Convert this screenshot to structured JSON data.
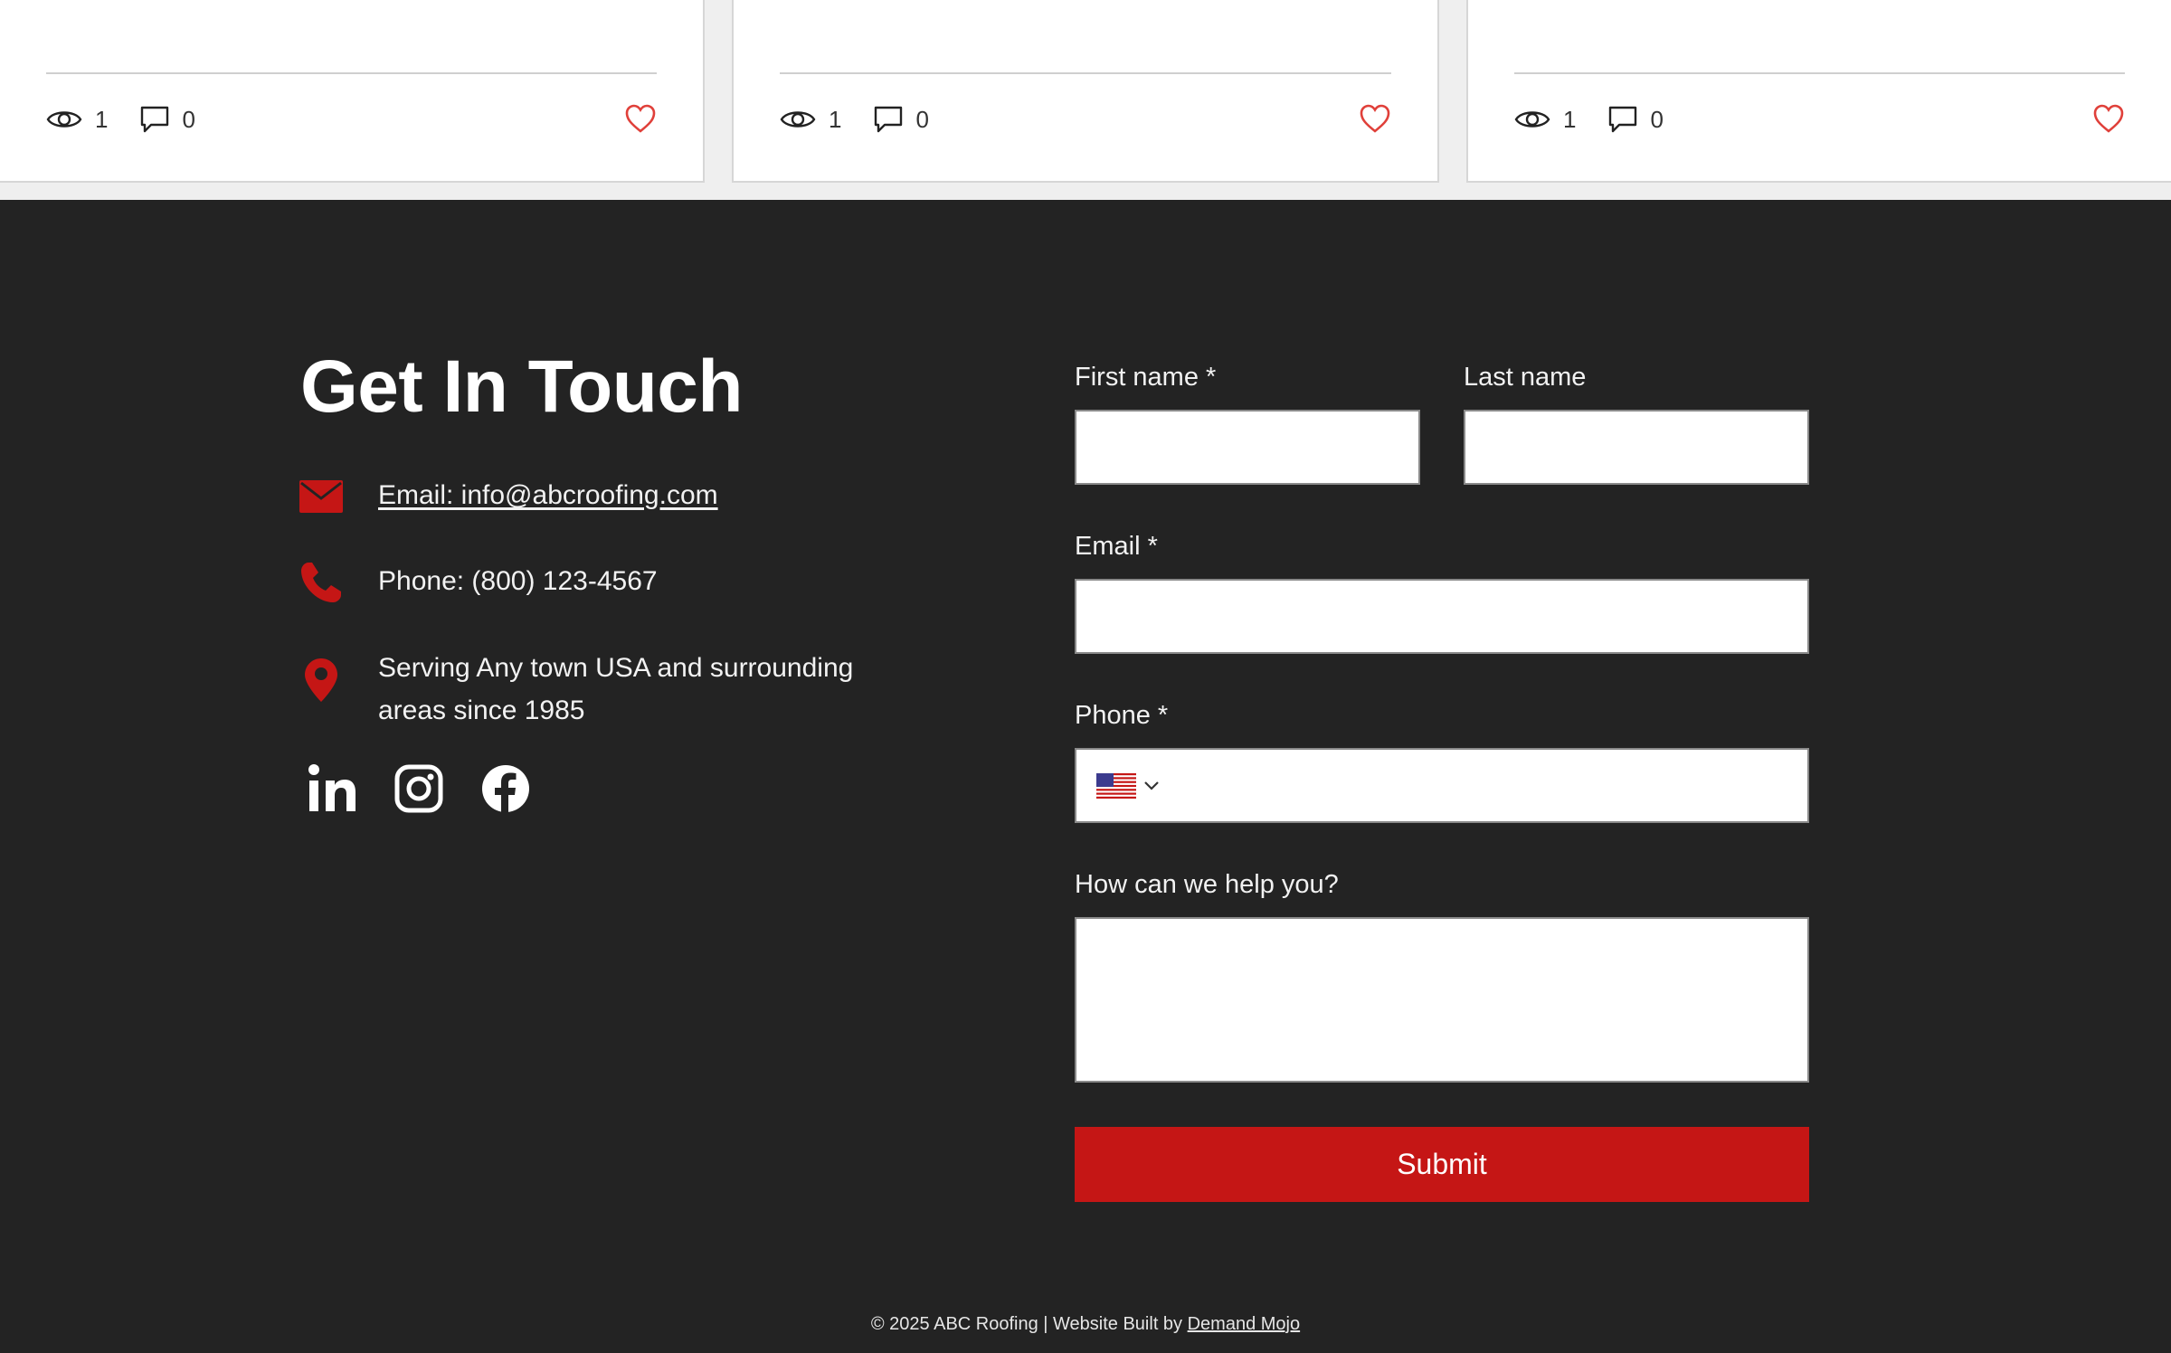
{
  "cards": [
    {
      "views": "1",
      "comments": "0"
    },
    {
      "views": "1",
      "comments": "0"
    },
    {
      "views": "1",
      "comments": "0"
    }
  ],
  "contact": {
    "title": "Get In Touch",
    "email_label": "Email: info@abcroofing.com",
    "phone_label": "Phone: (800) 123-4567",
    "location_line1": "Serving Any town USA and surrounding",
    "location_line2": "areas since 1985"
  },
  "socials": [
    "linkedin-icon",
    "instagram-icon",
    "facebook-icon"
  ],
  "form": {
    "first_name_label": "First name *",
    "last_name_label": "Last name",
    "email_label": "Email *",
    "phone_label": "Phone *",
    "help_label": "How can we help you?",
    "first_name_value": "",
    "last_name_value": "",
    "email_value": "",
    "phone_value": "",
    "help_value": "",
    "submit_label": "Submit"
  },
  "footer": {
    "copyright_text": "© 2025 ABC Roofing | Website Built by ",
    "builder_link": "Demand Mojo"
  },
  "colors": {
    "accent": "#c51615",
    "footer_bg": "#232323",
    "like_heart": "#e0403a"
  }
}
